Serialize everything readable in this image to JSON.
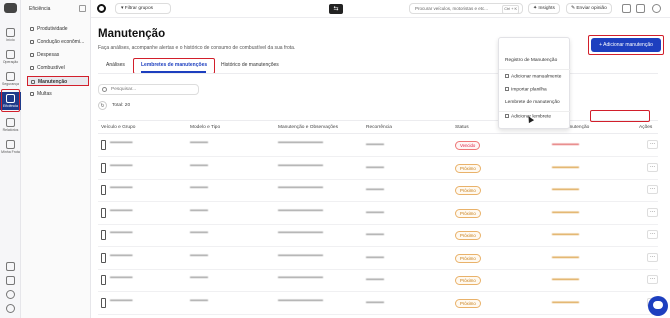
{
  "rail": {
    "items": [
      {
        "label": "Início",
        "icon": "home-icon"
      },
      {
        "label": "Operação",
        "icon": "grid-icon"
      },
      {
        "label": "Segurança",
        "icon": "shield-icon"
      },
      {
        "label": "Eficiência",
        "icon": "gauge-icon"
      },
      {
        "label": "Relatórios",
        "icon": "report-icon"
      },
      {
        "label": "Minha Frota",
        "icon": "truck-icon"
      }
    ]
  },
  "sidebar": {
    "title": "Eficiência",
    "items": [
      {
        "label": "Produtividade",
        "icon": "trend-icon"
      },
      {
        "label": "Condução econômi...",
        "icon": "leaf-icon"
      },
      {
        "label": "Despesas",
        "icon": "dollar-icon"
      },
      {
        "label": "Combustível",
        "icon": "fuel-icon"
      },
      {
        "label": "Manutenção",
        "icon": "wrench-icon"
      },
      {
        "label": "Multas",
        "icon": "ticket-icon"
      }
    ]
  },
  "topbar": {
    "filter_label": "Filtrar grupos",
    "search_placeholder": "Procurar veículos, motoristas e etc...",
    "shortcut": "Ctrl + K",
    "insights_label": "Insights",
    "feedback_label": "Enviar opinião"
  },
  "page": {
    "title": "Manutenção",
    "subtitle": "Faça análises, acompanhe alertas e o histórico de consumo de combustível da sua frota.",
    "tabs": [
      "Análises",
      "Lembretes de manutenções",
      "Histórico de manutenções"
    ],
    "search_placeholder": "Pesquisar...",
    "total": "Total: 20",
    "add_button": "+ Adicionar manutenção"
  },
  "table": {
    "headers": [
      "Veículo e Grupo",
      "Modelo e Tipo",
      "Manutenção e Observações",
      "Recorrência",
      "Status",
      "Próxima manutenção",
      "Ações"
    ],
    "rows": [
      {
        "status": "Vencido",
        "status_color": "red",
        "next_color": "#e06060"
      },
      {
        "status": "Próximo",
        "status_color": "orange",
        "next_color": "#d99a3a"
      },
      {
        "status": "Próximo",
        "status_color": "orange",
        "next_color": "#d99a3a"
      },
      {
        "status": "Próximo",
        "status_color": "orange",
        "next_color": "#d99a3a"
      },
      {
        "status": "Próximo",
        "status_color": "orange",
        "next_color": "#d99a3a"
      },
      {
        "status": "Próximo",
        "status_color": "orange",
        "next_color": "#d99a3a"
      },
      {
        "status": "Próximo",
        "status_color": "orange",
        "next_color": "#d99a3a"
      },
      {
        "status": "Próximo",
        "status_color": "orange",
        "next_color": "#d99a3a"
      }
    ]
  },
  "dropdown": {
    "section1": "Registro de Manutenção",
    "item1": "Adicionar manualmente",
    "item2": "Importar planilha",
    "section2": "Lembrete de manutenção",
    "item3": "Adicionar lembrete"
  },
  "colors": {
    "accent": "#1d3fbf",
    "highlight": "#d21f2b"
  }
}
